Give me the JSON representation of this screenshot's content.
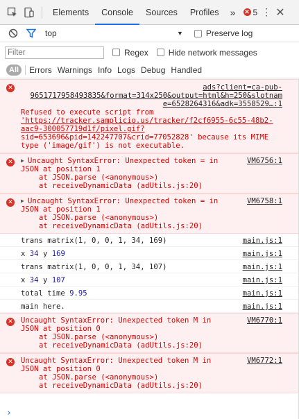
{
  "tabbar": {
    "tabs": [
      "Elements",
      "Console",
      "Sources",
      "Profiles"
    ],
    "active_tab": "Console",
    "more": "»",
    "error_count": "5",
    "kebab": "⋮",
    "close": "✕"
  },
  "toolbar": {
    "context": "top",
    "preserve_log": "Preserve log"
  },
  "filter": {
    "placeholder": "Filter",
    "regex": "Regex",
    "hide_network": "Hide network messages"
  },
  "levels": {
    "all": "All",
    "items": [
      "Errors",
      "Warnings",
      "Info",
      "Logs",
      "Debug",
      "Handled"
    ]
  },
  "messages": [
    {
      "type": "error",
      "source_lines": [
        "ads?client=ca-pub-",
        "9651717958493835&format=314x250&output=html&h=250&slotnam",
        "e=6528264316&adk=3558529…:1"
      ],
      "text_lines": [
        "Refused to execute script from",
        "'https://tracker.samplicio.us/tracker/f2cf6955-6c55-48b2-",
        "aac9-300057719d1f/pixel.gif?",
        "sid=653696&pid=142247707&crid=77052828' because its MIME",
        "type ('image/gif') is not executable."
      ]
    },
    {
      "type": "error",
      "source": "VM6756:1",
      "text_lines": [
        "Uncaught SyntaxError: Unexpected token = in",
        "JSON at position 1",
        "at JSON.parse (<anonymous>)",
        "at receiveDynamicData (adUtils.js:20)"
      ]
    },
    {
      "type": "error",
      "source": "VM6758:1",
      "text_lines": [
        "Uncaught SyntaxError: Unexpected token = in",
        "JSON at position 1",
        "at JSON.parse (<anonymous>)",
        "at receiveDynamicData (adUtils.js:20)"
      ]
    },
    {
      "type": "log",
      "text": "trans matrix(1, 0, 0, 1, 34, 169)",
      "source": "main.js:1"
    },
    {
      "type": "log",
      "text_parts": [
        "x",
        "34",
        "y",
        "169"
      ],
      "source": "main.js:1"
    },
    {
      "type": "log",
      "text": "trans matrix(1, 0, 0, 1, 34, 107)",
      "source": "main.js:1"
    },
    {
      "type": "log",
      "text_parts": [
        "x",
        "34",
        "y",
        "107"
      ],
      "source": "main.js:1"
    },
    {
      "type": "log",
      "text_parts": [
        "total time",
        "9.95"
      ],
      "source": "main.js:1"
    },
    {
      "type": "log",
      "text": "main here.",
      "source": "main.js:1"
    },
    {
      "type": "error",
      "source": "VM6770:1",
      "text_lines": [
        "Uncaught SyntaxError: Unexpected token M in",
        "JSON at position 0",
        "at JSON.parse (<anonymous>)",
        "at receiveDynamicData (adUtils.js:20)"
      ]
    },
    {
      "type": "error",
      "source": "VM6772:1",
      "text_lines": [
        "Uncaught SyntaxError: Unexpected token M in",
        "JSON at position 0",
        "at JSON.parse (<anonymous>)",
        "at receiveDynamicData (adUtils.js:20)"
      ]
    }
  ],
  "prompt": "›",
  "colors": {
    "accent": "#1a73e8",
    "error": "#d93025",
    "error_bg": "#fef0f0",
    "number": "#1a1aa6"
  }
}
